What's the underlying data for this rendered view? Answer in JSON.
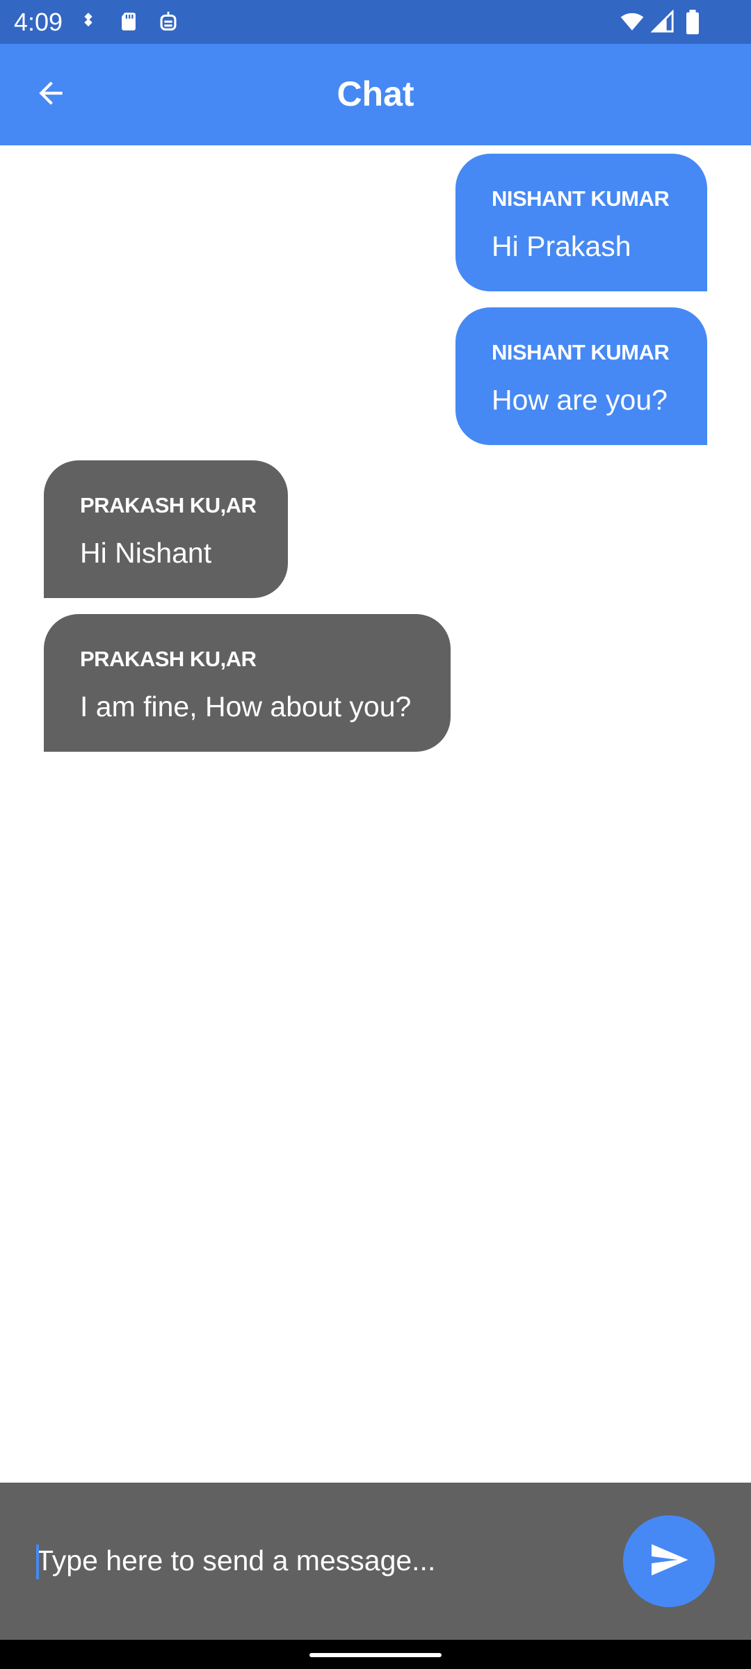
{
  "status_bar": {
    "time": "4:09",
    "icons": [
      "transit-icon",
      "sd-card-icon",
      "robot-icon",
      "wifi-icon",
      "signal-icon",
      "battery-icon"
    ]
  },
  "app_bar": {
    "title": "Chat",
    "back_icon": "arrow-back-icon"
  },
  "messages": [
    {
      "direction": "outgoing",
      "sender": "NISHANT KUMAR",
      "text": "Hi Prakash"
    },
    {
      "direction": "outgoing",
      "sender": "NISHANT KUMAR",
      "text": "How are you?"
    },
    {
      "direction": "incoming",
      "sender": "PRAKASH KU,AR",
      "text": "Hi Nishant"
    },
    {
      "direction": "incoming",
      "sender": "PRAKASH KU,AR",
      "text": "I am fine, How about you?"
    }
  ],
  "composer": {
    "placeholder": "Type here to send a message...",
    "value": "",
    "send_icon": "send-icon"
  },
  "colors": {
    "status_bar": "#3367c4",
    "primary": "#4689f4",
    "incoming_bubble": "#616161",
    "composer_bg": "#616161"
  }
}
